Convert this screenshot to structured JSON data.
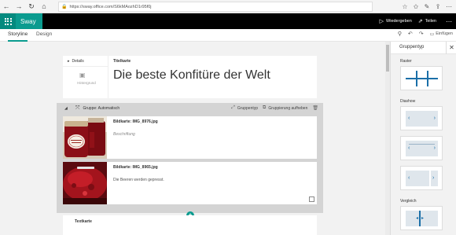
{
  "browser": {
    "url": "https://sway.office.com/S6kMAozhD1r95f0j",
    "icons": [
      "back-icon",
      "forward-icon",
      "refresh-icon",
      "home-icon",
      "lock-icon",
      "star-icon",
      "favorites-icon",
      "pen-icon",
      "share-icon",
      "more-icon"
    ]
  },
  "appbar": {
    "brand": "Sway",
    "play_label": "Wiedergeben",
    "share_label": "Teilen",
    "more": "⋯"
  },
  "tabs": {
    "storyline": "Storyline",
    "design": "Design"
  },
  "toolbar": {
    "insert_label": "Einfügen"
  },
  "title_card": {
    "details_label": "Details",
    "background_label": "Hintergrund",
    "kind_label": "Titelkarte",
    "title": "Die beste Konfitüre der Welt"
  },
  "group": {
    "label": "Gruppe: Automatisch",
    "group_type_btn": "Gruppentyp",
    "ungroup_btn": "Gruppierung aufheben"
  },
  "image_cards": [
    {
      "label": "Bildkarte: IMG_8976.jpg",
      "caption": "Beschriftung",
      "caption_is_placeholder": true
    },
    {
      "label": "Bildkarte: IMG_8965.jpg",
      "caption": "Die Beeren werden gepresst.",
      "caption_is_placeholder": false
    }
  ],
  "text_card": {
    "label": "Textkarte"
  },
  "panel": {
    "title": "Gruppentyp",
    "sections": [
      {
        "label": "Raster"
      },
      {
        "label": "Diashow"
      },
      {
        "label": "Vergleich"
      }
    ]
  },
  "colors": {
    "accent": "#0a9b8f",
    "appbar": "#000000",
    "layout_blue": "#1a6fa8"
  }
}
